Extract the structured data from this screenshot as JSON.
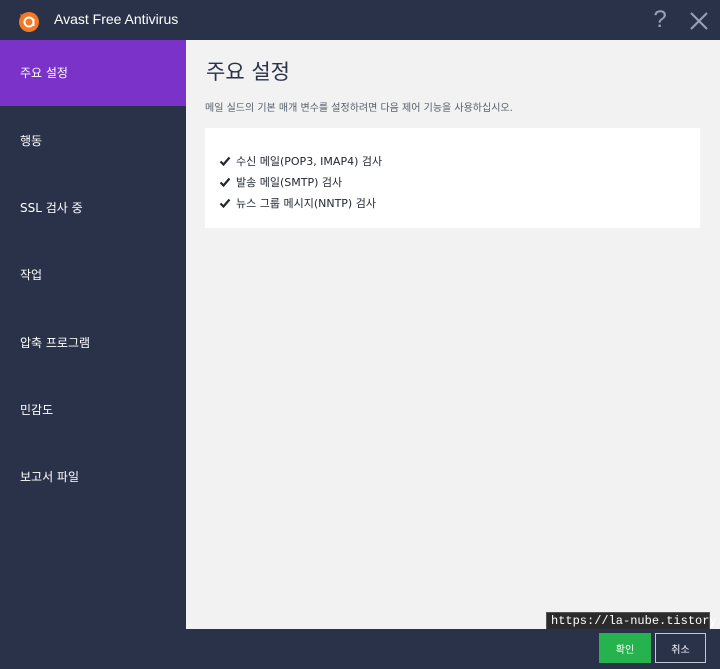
{
  "window": {
    "title": "Avast Free Antivirus",
    "help_label": "?",
    "colors": {
      "titlebar": "#2a3249",
      "accent": "#7a32c8",
      "brand": "#f47920",
      "ok": "#26b24c"
    }
  },
  "sidebar": {
    "items": [
      {
        "label": "주요 설정",
        "active": true
      },
      {
        "label": "행동",
        "active": false
      },
      {
        "label": "SSL 검사 중",
        "active": false
      },
      {
        "label": "작업",
        "active": false
      },
      {
        "label": "압축 프로그램",
        "active": false
      },
      {
        "label": "민감도",
        "active": false
      },
      {
        "label": "보고서 파일",
        "active": false
      }
    ]
  },
  "main": {
    "title": "주요 설정",
    "description": "메일 실드의 기본 매개 변수를 설정하려면 다음 제어 기능을 사용하십시오.",
    "options": [
      {
        "label": "수신 메일(POP3, IMAP4) 검사",
        "checked": true
      },
      {
        "label": "발송 메일(SMTP) 검사",
        "checked": true
      },
      {
        "label": "뉴스 그룹 메시지(NNTP) 검사",
        "checked": true
      }
    ]
  },
  "watermark": "https://la-nube.tistory.com",
  "footer": {
    "ok_label": "확인",
    "cancel_label": "취소"
  },
  "icons": {
    "logo": "avast-logo-icon",
    "help": "question-mark-icon",
    "close": "close-icon",
    "checkbox": "checkmark-icon"
  }
}
